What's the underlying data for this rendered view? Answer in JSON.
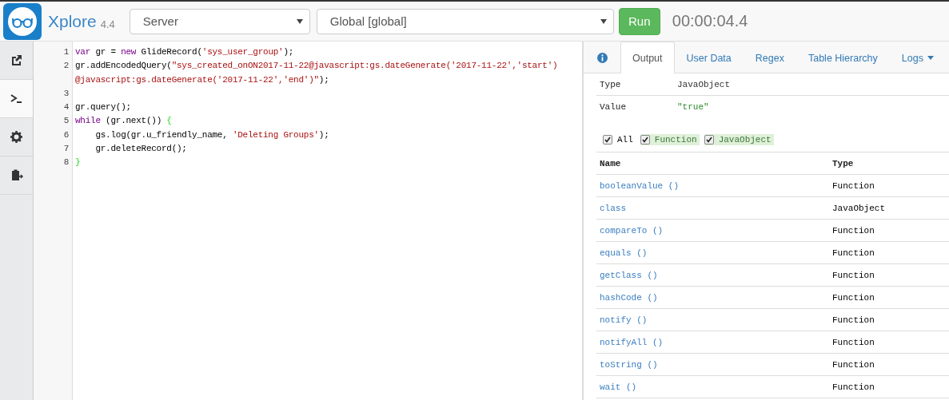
{
  "header": {
    "app_name": "Xplore",
    "version": "4.4",
    "context": {
      "value": "Server"
    },
    "scope": {
      "value": "Global [global]"
    },
    "run_button": "Run",
    "elapsed": "00:00:04.4"
  },
  "sidebar": {
    "items": [
      {
        "selected": false
      },
      {
        "selected": true
      },
      {
        "selected": false
      },
      {
        "selected": false
      }
    ]
  },
  "editor": {
    "rows": [
      {
        "number": "1",
        "segments": [
          {
            "kind": "keyword",
            "text": "var"
          },
          {
            "kind": "plain",
            "text": " gr = "
          },
          {
            "kind": "keyword",
            "text": "new"
          },
          {
            "kind": "plain",
            "text": " GlideRecord("
          },
          {
            "kind": "string",
            "text": "'sys_user_group'"
          },
          {
            "kind": "plain",
            "text": ");"
          }
        ]
      },
      {
        "number": "2",
        "segments": [
          {
            "kind": "plain",
            "text": "gr.addEncodedQuery("
          },
          {
            "kind": "string",
            "text": "\"sys_created_onON2017-11-22@javascript:gs.dateGenerate('2017-11-22','start')"
          }
        ]
      },
      {
        "segments": [
          {
            "kind": "string",
            "text": "@javascript:gs.dateGenerate('2017-11-22','end')\""
          },
          {
            "kind": "plain",
            "text": ");"
          }
        ]
      },
      {
        "number": "3",
        "segments": []
      },
      {
        "number": "4",
        "segments": [
          {
            "kind": "plain",
            "text": "gr.query();"
          }
        ]
      },
      {
        "number": "5",
        "segments": [
          {
            "kind": "keyword",
            "text": "while"
          },
          {
            "kind": "plain",
            "text": " (gr.next()) "
          },
          {
            "kind": "bracket",
            "text": "{"
          }
        ]
      },
      {
        "number": "6",
        "segments": [
          {
            "kind": "plain",
            "text": "    gs.log(gr.u_friendly_name, "
          },
          {
            "kind": "string",
            "text": "'Deleting Groups'"
          },
          {
            "kind": "plain",
            "text": ");"
          }
        ]
      },
      {
        "number": "7",
        "segments": [
          {
            "kind": "plain",
            "text": "    gr.deleteRecord();"
          }
        ]
      },
      {
        "number": "8",
        "segments": [
          {
            "kind": "bracket",
            "text": "}"
          }
        ]
      }
    ]
  },
  "output": {
    "tabs": [
      {
        "label": "Output",
        "selected": true
      },
      {
        "label": "User Data",
        "selected": false
      },
      {
        "label": "Regex",
        "selected": false
      },
      {
        "label": "Table Hierarchy",
        "selected": false
      },
      {
        "label": "Logs",
        "selected": false
      }
    ],
    "properties": [
      {
        "label": "Type",
        "value": "JavaObject",
        "kind": "plain"
      },
      {
        "label": "Value",
        "value": "\"true\"",
        "kind": "string"
      }
    ],
    "filters": [
      {
        "label": "All",
        "checked": true,
        "highlighted": false
      },
      {
        "label": "Function",
        "checked": true,
        "highlighted": true
      },
      {
        "label": "JavaObject",
        "checked": true,
        "highlighted": true
      }
    ],
    "table": {
      "columns": [
        "Name",
        "Type"
      ],
      "rows": [
        {
          "name": "booleanValue ()",
          "type": "Function"
        },
        {
          "name": "class",
          "type": "JavaObject"
        },
        {
          "name": "compareTo ()",
          "type": "Function"
        },
        {
          "name": "equals ()",
          "type": "Function"
        },
        {
          "name": "getClass ()",
          "type": "Function"
        },
        {
          "name": "hashCode ()",
          "type": "Function"
        },
        {
          "name": "notify ()",
          "type": "Function"
        },
        {
          "name": "notifyAll ()",
          "type": "Function"
        },
        {
          "name": "toString ()",
          "type": "Function"
        },
        {
          "name": "wait ()",
          "type": "Function"
        }
      ]
    }
  }
}
